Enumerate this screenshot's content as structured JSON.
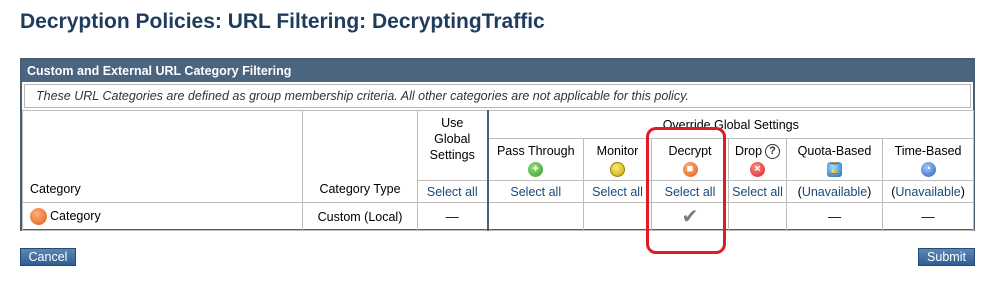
{
  "page": {
    "title": "Decryption Policies: URL Filtering: DecryptingTraffic"
  },
  "panel": {
    "header": "Custom and External URL Category Filtering",
    "note": "These URL Categories are defined as group membership criteria. All other categories are not applicable for this policy."
  },
  "table": {
    "use_global": "Use Global Settings",
    "override": "Override Global Settings",
    "col_category": "Category",
    "col_type": "Category Type",
    "options": [
      {
        "label": "Pass Through",
        "icon": "pass-through-icon",
        "select": "Select all"
      },
      {
        "label": "Monitor",
        "icon": "monitor-icon",
        "select": "Select all"
      },
      {
        "label": "Decrypt",
        "icon": "decrypt-icon",
        "select": "Select all"
      },
      {
        "label": "Drop",
        "icon": "drop-icon",
        "select": "Select all"
      },
      {
        "label": "Quota-Based",
        "icon": "quota-icon",
        "select_prefix": "(",
        "select_link": "Unavailable",
        "select_suffix": ")"
      },
      {
        "label": "Time-Based",
        "icon": "time-icon",
        "select_prefix": "(",
        "select_link": "Unavailable",
        "select_suffix": ")"
      }
    ],
    "global_select": "Select all",
    "row": {
      "category": "Category",
      "type": "Custom (Local)",
      "global": "—",
      "quota": "—",
      "time": "—",
      "decrypt_checked": true
    }
  },
  "buttons": {
    "cancel": "Cancel",
    "submit": "Submit"
  },
  "colors": {
    "title": "#1f3b5e",
    "header_bar": "#4b6480",
    "highlight": "#e01b24",
    "button": "#2f5f92"
  }
}
